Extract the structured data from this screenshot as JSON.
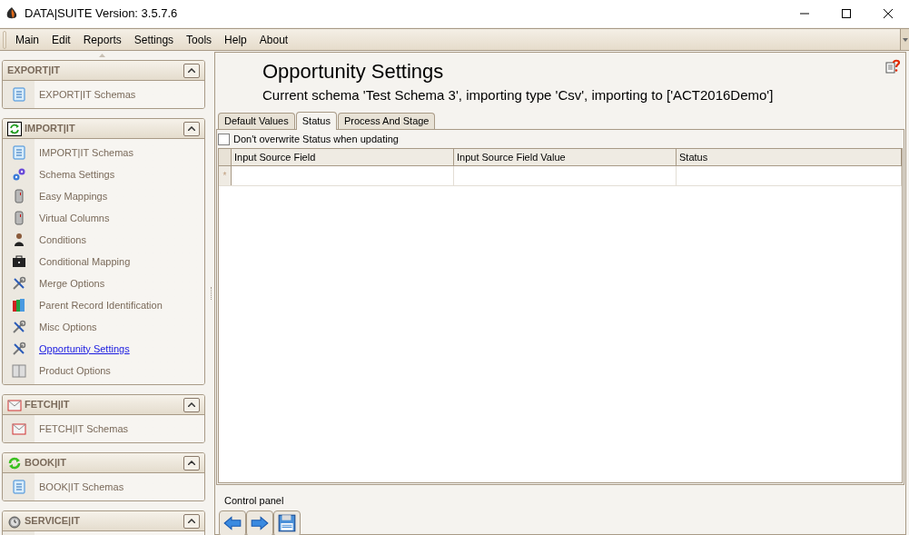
{
  "window": {
    "title": "DATA|SUITE Version: 3.5.7.6"
  },
  "menu": [
    "Main",
    "Edit",
    "Reports",
    "Settings",
    "Tools",
    "Help",
    "About"
  ],
  "sidebar": {
    "groups": [
      {
        "title": "EXPORT|IT",
        "kind": "none",
        "expanded": true,
        "items": [
          {
            "label": "EXPORT|IT Schemas",
            "kind": "list",
            "selected": false
          }
        ]
      },
      {
        "title": "IMPORT|IT",
        "kind": "sync",
        "expanded": true,
        "items": [
          {
            "label": "IMPORT|IT Schemas",
            "kind": "list",
            "selected": false
          },
          {
            "label": "Schema Settings",
            "kind": "gears",
            "selected": false
          },
          {
            "label": "Easy Mappings",
            "kind": "cylinder",
            "selected": false
          },
          {
            "label": "Virtual Columns",
            "kind": "cylinder",
            "selected": false
          },
          {
            "label": "Conditions",
            "kind": "person",
            "selected": false
          },
          {
            "label": "Conditional Mapping",
            "kind": "briefcase",
            "selected": false
          },
          {
            "label": "Merge Options",
            "kind": "tools",
            "selected": false
          },
          {
            "label": "Parent Record Identification",
            "kind": "books",
            "selected": false
          },
          {
            "label": "Misc Options",
            "kind": "tools",
            "selected": false
          },
          {
            "label": "Opportunity Settings",
            "kind": "tools",
            "selected": true
          },
          {
            "label": "Product Options",
            "kind": "box",
            "selected": false
          }
        ]
      },
      {
        "title": "FETCH|IT",
        "kind": "mail",
        "expanded": true,
        "items": [
          {
            "label": "FETCH|IT Schemas",
            "kind": "mail",
            "selected": false
          }
        ]
      },
      {
        "title": "BOOK|IT",
        "kind": "arrows",
        "expanded": true,
        "items": [
          {
            "label": "BOOK|IT Schemas",
            "kind": "list",
            "selected": false
          }
        ]
      },
      {
        "title": "SERVICE|IT",
        "kind": "clock",
        "expanded": true
      }
    ]
  },
  "page": {
    "title": "Opportunity Settings",
    "subtitle": "Current schema 'Test Schema 3', importing type 'Csv', importing to ['ACT2016Demo']"
  },
  "tabs": [
    {
      "label": "Default Values",
      "selected": false
    },
    {
      "label": "Status",
      "selected": true
    },
    {
      "label": "Process And Stage",
      "selected": false
    }
  ],
  "option": {
    "label": "Don't overwrite Status when updating",
    "checked": false
  },
  "grid": {
    "columns": [
      "Input Source Field",
      "Input Source Field Value",
      "Status"
    ],
    "new_row_marker": "*"
  },
  "control_panel": {
    "label": "Control panel",
    "buttons": [
      {
        "kind": "back"
      },
      {
        "kind": "forward"
      },
      {
        "kind": "save"
      }
    ]
  }
}
